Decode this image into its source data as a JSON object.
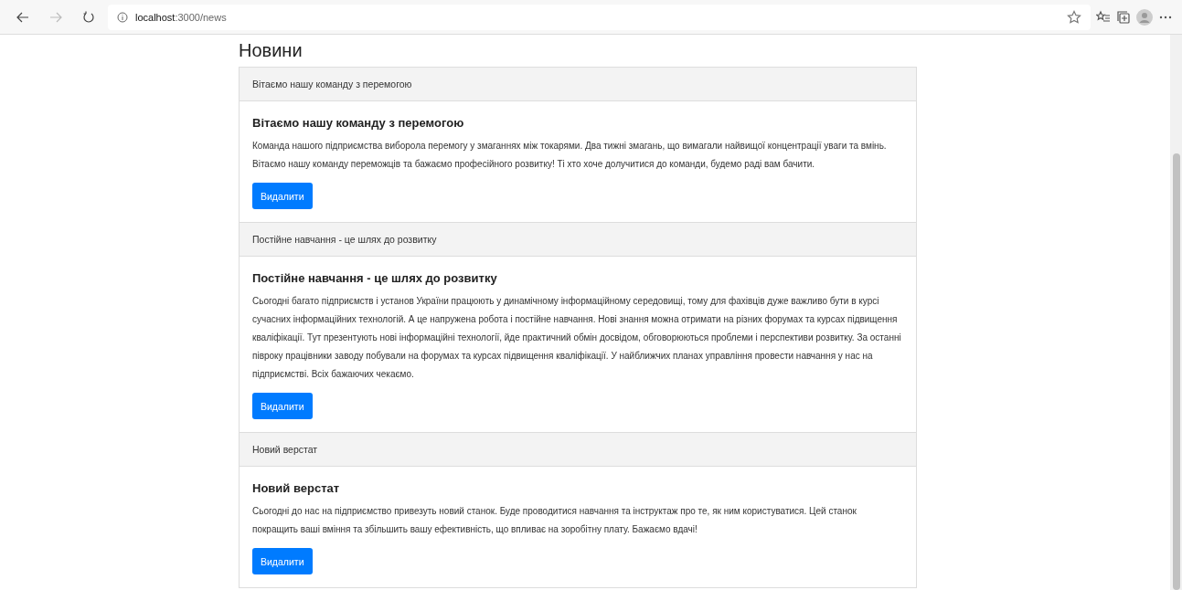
{
  "browser": {
    "url_host": "localhost",
    "url_path": ":3000/news"
  },
  "page": {
    "title": "Новини"
  },
  "news": [
    {
      "header": "Вітаємо нашу команду з перемогою",
      "title": "Вітаємо нашу команду з перемогою",
      "text": "Команда нашого підприємства виборола перемогу у змаганнях між токарями. Два тижні змагань, що вимагали найвищої концентрації уваги та вмінь. Вітаємо нашу команду переможців та бажаємо професійного розвитку! Ті хто хоче долучитися до команди, будемо раді вам бачити.",
      "button": "Видалити"
    },
    {
      "header": "Постійне навчання - це шлях до розвитку",
      "title": "Постійне навчання - це шлях до розвитку",
      "text": "Сьогодні багато підприємств і установ України працюють у динамічному інформаційному середовищі, тому для фахівців дуже важливо бути в курсі сучасних інформаційних технологій. А це напружена робота і постійне навчання. Нові знання можна отримати на різних форумах та курсах підвищення кваліфікації. Тут презентують нові інформаційні технології, йде практичний обмін досвідом, обговорюються проблеми і перспективи розвитку. За останні півроку працівники заводу побували на форумах та курсах підвищення кваліфікації. У найближчих планах управління провести навчання у нас на підприємстві. Всіх бажаючих чекаємо.",
      "button": "Видалити"
    },
    {
      "header": "Новий верстат",
      "title": "Новий верстат",
      "text": "Сьогодні до нас на підприємство привезуть новий станок. Буде проводитися навчання та інструктаж про те, як ним користуватися. Цей станок покращить ваші вміння та збільшить вашу ефективність, що впливає на зоробітну плату. Бажаємо вдачі!",
      "button": "Видалити"
    }
  ]
}
